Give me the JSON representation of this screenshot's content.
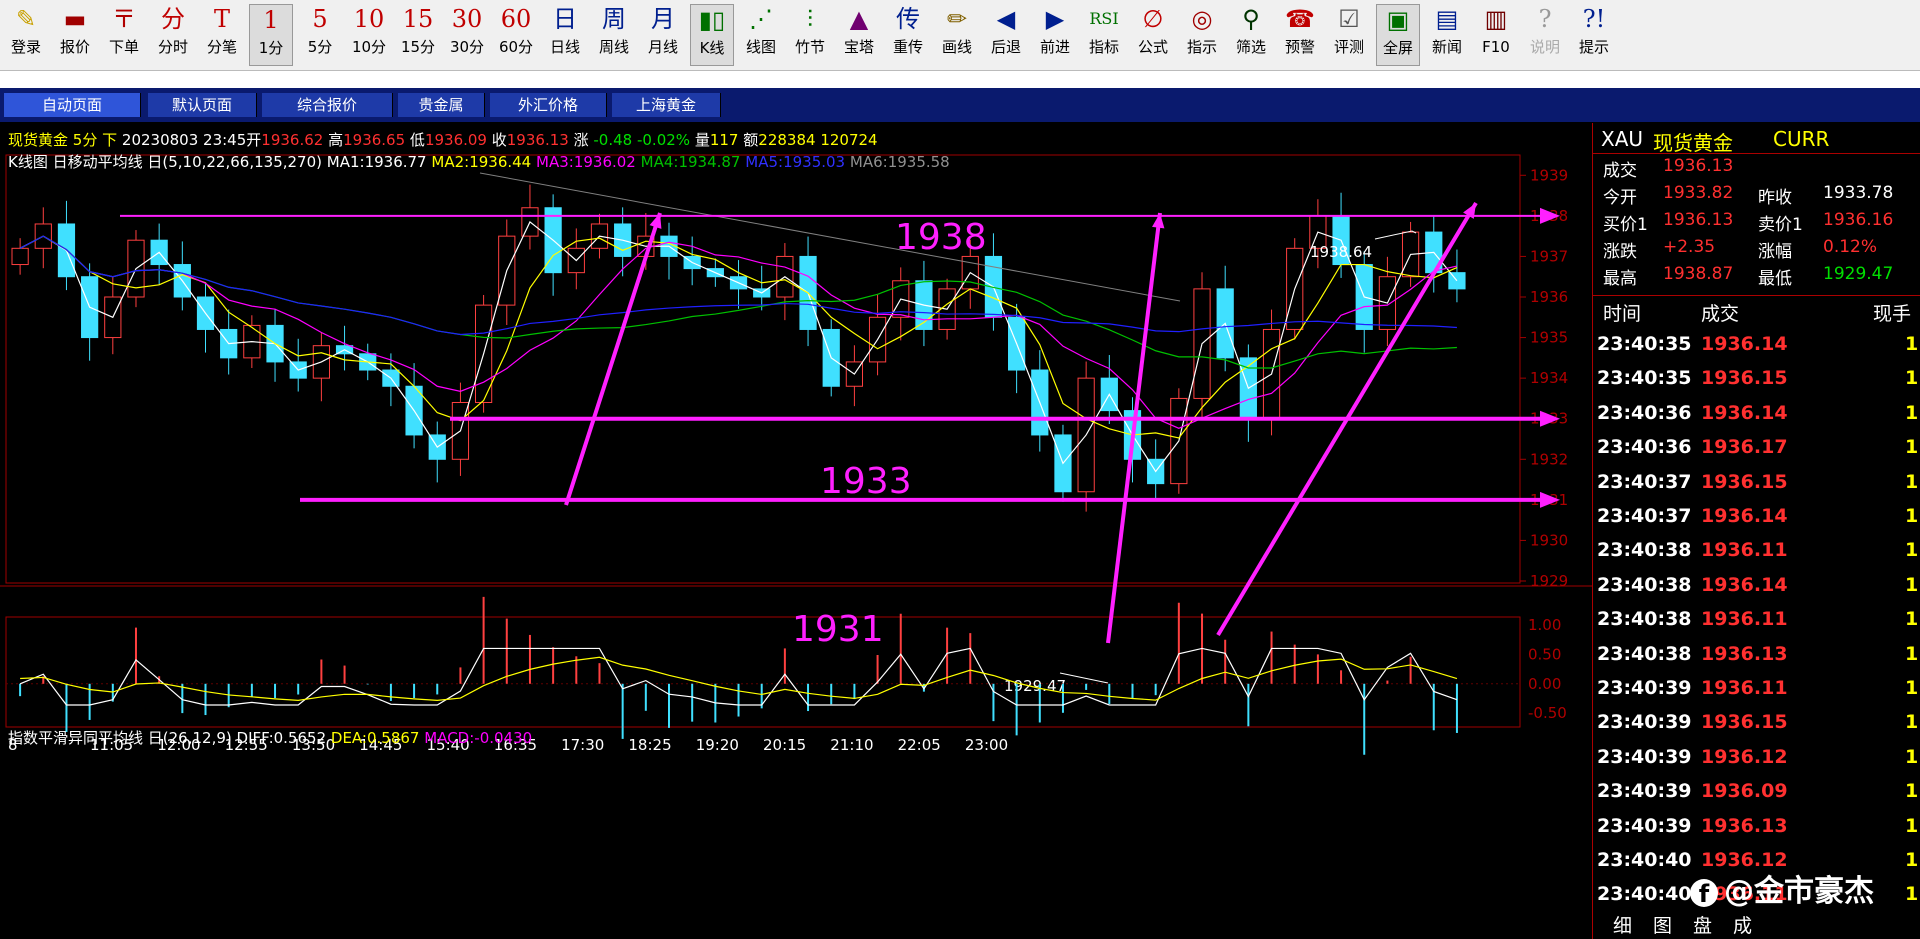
{
  "toolbar": [
    {
      "id": "login",
      "label": "登录",
      "icon": "✎",
      "color": "#c8a000",
      "icon_name": "pencil-icon"
    },
    {
      "id": "quote",
      "label": "报价",
      "icon": "▬",
      "color": "#a00000",
      "icon_name": "quote-icon"
    },
    {
      "id": "order",
      "label": "下单",
      "icon": "〒",
      "color": "#b00000",
      "icon_name": "order-icon"
    },
    {
      "id": "timeshare",
      "label": "分时",
      "icon": "分",
      "color": "#c00000",
      "icon_name": "timeshare-icon"
    },
    {
      "id": "ticks",
      "label": "分笔",
      "icon": "T",
      "color": "#c00000",
      "icon_name": "tick-icon"
    },
    {
      "id": "m1",
      "label": "1分",
      "icon": "1",
      "color": "#c00000",
      "icon_name": "period-1m-icon"
    },
    {
      "id": "m5",
      "label": "5分",
      "icon": "5",
      "color": "#c00000",
      "icon_name": "period-5m-icon"
    },
    {
      "id": "m10",
      "label": "10分",
      "icon": "10",
      "color": "#c00000",
      "icon_name": "period-10m-icon"
    },
    {
      "id": "m15",
      "label": "15分",
      "icon": "15",
      "color": "#c00000",
      "icon_name": "period-15m-icon"
    },
    {
      "id": "m30",
      "label": "30分",
      "icon": "30",
      "color": "#c00000",
      "icon_name": "period-30m-icon"
    },
    {
      "id": "m60",
      "label": "60分",
      "icon": "60",
      "color": "#c00000",
      "icon_name": "period-60m-icon"
    },
    {
      "id": "day",
      "label": "日线",
      "icon": "日",
      "color": "#001f8f",
      "icon_name": "daily-icon"
    },
    {
      "id": "week",
      "label": "周线",
      "icon": "周",
      "color": "#001f8f",
      "icon_name": "weekly-icon"
    },
    {
      "id": "month",
      "label": "月线",
      "icon": "月",
      "color": "#001f8f",
      "icon_name": "monthly-icon"
    },
    {
      "id": "kline",
      "label": "K线",
      "icon": "▮▯",
      "color": "#007000",
      "icon_name": "candlestick-icon"
    },
    {
      "id": "lineplot",
      "label": "线图",
      "icon": "⋰",
      "color": "#007000",
      "icon_name": "line-chart-icon"
    },
    {
      "id": "bamboo",
      "label": "竹节",
      "icon": "⫶",
      "color": "#007000",
      "icon_name": "ohlc-icon"
    },
    {
      "id": "tower",
      "label": "宝塔",
      "icon": "▲",
      "color": "#700070",
      "icon_name": "tower-icon"
    },
    {
      "id": "retrans",
      "label": "重传",
      "icon": "传",
      "color": "#001f8f",
      "icon_name": "retransmit-icon"
    },
    {
      "id": "draw",
      "label": "画线",
      "icon": "✏",
      "color": "#806000",
      "icon_name": "draw-line-icon"
    },
    {
      "id": "back",
      "label": "后退",
      "icon": "◀",
      "color": "#001f8f",
      "icon_name": "back-icon"
    },
    {
      "id": "forward",
      "label": "前进",
      "icon": "▶",
      "color": "#001f8f",
      "icon_name": "forward-icon"
    },
    {
      "id": "indicator",
      "label": "指标",
      "icon": "RSI",
      "color": "#007000",
      "icon_name": "rsi-icon"
    },
    {
      "id": "formula",
      "label": "公式",
      "icon": "∅",
      "color": "#c00000",
      "icon_name": "formula-icon"
    },
    {
      "id": "signal",
      "label": "指示",
      "icon": "◎",
      "color": "#a00000",
      "icon_name": "signal-icon"
    },
    {
      "id": "screen",
      "label": "筛选",
      "icon": "⚲",
      "color": "#003300",
      "icon_name": "binoculars-icon"
    },
    {
      "id": "alert",
      "label": "预警",
      "icon": "☎",
      "color": "#c00000",
      "icon_name": "alert-icon"
    },
    {
      "id": "review",
      "label": "评测",
      "icon": "☑",
      "color": "#555555",
      "icon_name": "review-icon"
    },
    {
      "id": "fullscreen",
      "label": "全屏",
      "icon": "▣",
      "color": "#007000",
      "icon_name": "fullscreen-icon"
    },
    {
      "id": "news",
      "label": "新闻",
      "icon": "▤",
      "color": "#001f8f",
      "icon_name": "news-icon"
    },
    {
      "id": "f10",
      "label": "F10",
      "icon": "▥",
      "color": "#700000",
      "icon_name": "f10-icon"
    },
    {
      "id": "help",
      "label": "说明",
      "icon": "?",
      "color": "#999999",
      "icon_name": "help-disabled-icon"
    },
    {
      "id": "tips",
      "label": "提示",
      "icon": "?!",
      "color": "#001f8f",
      "icon_name": "tips-icon"
    }
  ],
  "tabs": [
    "自动页面",
    "默认页面",
    "综合报价",
    "贵金属",
    "外汇价格",
    "上海黄金"
  ],
  "header": {
    "symbol": "现货黄金",
    "period": "5分",
    "dir": "下",
    "datetime": "20230803 23:45",
    "open_label": "开",
    "open": "1936.62",
    "high_label": "高",
    "high": "1936.65",
    "low_label": "低",
    "low": "1936.09",
    "close_label": "收",
    "close": "1936.13",
    "chg_label": "涨",
    "chg": "-0.48",
    "chg_pct": "-0.02%",
    "vol_label": "量",
    "vol": "117",
    "amt_label": "额",
    "amt": "228384",
    "extra": "120724"
  },
  "ma_line": {
    "title": "K线图 日移动平均线 日(5,10,22,66,135,270)",
    "ma1": "MA1:1936.77",
    "ma2": "MA2:1936.44",
    "ma3": "MA3:1936.02",
    "ma4": "MA4:1934.87",
    "ma5": "MA5:1935.03",
    "ma6": "MA6:1935.58"
  },
  "macd_line": {
    "title": "指数平滑异同平均线 日(26,12,9)",
    "diff": "DIFF:0.5652",
    "dea": "DEA:0.5867",
    "macd": "MACD:-0.0430"
  },
  "annotations": {
    "l1938": "1938",
    "l1933": "1933",
    "l1931": "1931",
    "high_mark": "1938.64",
    "low_mark": "1929.47"
  },
  "price_axis": [
    "1939",
    "1938",
    "1937",
    "1936",
    "1935",
    "1934",
    "1933",
    "1932",
    "1931",
    "1930",
    "1929"
  ],
  "macd_axis": [
    "1.00",
    "0.50",
    "0.00",
    "-0.50"
  ],
  "time_axis": [
    "8",
    "11:05",
    "12:00",
    "12:55",
    "13:50",
    "14:45",
    "15:40",
    "16:35",
    "17:30",
    "18:25",
    "19:20",
    "20:15",
    "21:10",
    "22:05",
    "23:00"
  ],
  "chart_data": {
    "type": "candlestick",
    "symbol": "XAU",
    "period": "5分",
    "close_path": [
      1937.2,
      1937.8,
      1936.5,
      1935.0,
      1936.0,
      1937.4,
      1936.8,
      1936.0,
      1935.2,
      1934.5,
      1935.3,
      1934.4,
      1934.0,
      1934.8,
      1934.6,
      1934.2,
      1933.8,
      1932.6,
      1932.0,
      1933.4,
      1935.8,
      1937.5,
      1938.2,
      1936.6,
      1937.2,
      1937.8,
      1937.0,
      1937.5,
      1937.0,
      1936.7,
      1936.5,
      1936.2,
      1936.0,
      1937.0,
      1935.2,
      1933.8,
      1934.4,
      1935.5,
      1936.4,
      1935.2,
      1936.2,
      1937.0,
      1935.5,
      1934.2,
      1932.6,
      1931.2,
      1934.0,
      1933.2,
      1932.0,
      1931.4,
      1933.5,
      1936.2,
      1934.5,
      1933.0,
      1935.2,
      1937.2,
      1938.0,
      1936.8,
      1935.2,
      1936.5,
      1937.6,
      1936.6,
      1936.2
    ],
    "ma_colors": {
      "ma1": "#ffffff",
      "ma2": "#ffff00",
      "ma3": "#ff00ff",
      "ma4": "#00c000",
      "ma5": "#0000ff",
      "ma6": "#808080"
    },
    "macd": {
      "diff": 0.5652,
      "dea": 0.5867,
      "macd": -0.043,
      "ylim": [
        -0.7,
        1.1
      ]
    },
    "ylim": [
      1929,
      1939.5
    ],
    "levels": [
      1938,
      1933,
      1931
    ],
    "high": 1938.64,
    "low": 1929.47
  },
  "panel": {
    "code": "XAU",
    "name": "现货黄金",
    "type": "CURR",
    "rows": [
      {
        "k": "成交",
        "v": "1936.13",
        "c": "#ff3030"
      },
      {
        "k": "今开",
        "v": "1933.82",
        "c": "#ff3030",
        "k2": "昨收",
        "v2": "1933.78",
        "c2": "#ffffff"
      },
      {
        "k": "买价1",
        "v": "1936.13",
        "c": "#ff3030",
        "k2": "卖价1",
        "v2": "1936.16",
        "c2": "#ff3030"
      },
      {
        "k": "涨跌",
        "v": "+2.35",
        "c": "#ff3030",
        "k2": "涨幅",
        "v2": "0.12%",
        "c2": "#ff3030"
      },
      {
        "k": "最高",
        "v": "1938.87",
        "c": "#ff3030",
        "k2": "最低",
        "v2": "1929.47",
        "c2": "#00e000"
      }
    ],
    "col_time": "时间",
    "col_price": "成交",
    "col_vol": "现手",
    "ticks": [
      {
        "t": "23:40:35",
        "p": "1936.14",
        "v": "1"
      },
      {
        "t": "23:40:35",
        "p": "1936.15",
        "v": "1"
      },
      {
        "t": "23:40:36",
        "p": "1936.14",
        "v": "1"
      },
      {
        "t": "23:40:36",
        "p": "1936.17",
        "v": "1"
      },
      {
        "t": "23:40:37",
        "p": "1936.15",
        "v": "1"
      },
      {
        "t": "23:40:37",
        "p": "1936.14",
        "v": "1"
      },
      {
        "t": "23:40:38",
        "p": "1936.11",
        "v": "1"
      },
      {
        "t": "23:40:38",
        "p": "1936.14",
        "v": "1"
      },
      {
        "t": "23:40:38",
        "p": "1936.11",
        "v": "1"
      },
      {
        "t": "23:40:38",
        "p": "1936.13",
        "v": "1"
      },
      {
        "t": "23:40:39",
        "p": "1936.11",
        "v": "1"
      },
      {
        "t": "23:40:39",
        "p": "1936.15",
        "v": "1"
      },
      {
        "t": "23:40:39",
        "p": "1936.12",
        "v": "1"
      },
      {
        "t": "23:40:39",
        "p": "1936.09",
        "v": "1"
      },
      {
        "t": "23:40:39",
        "p": "1936.13",
        "v": "1"
      },
      {
        "t": "23:40:40",
        "p": "1936.12",
        "v": "1"
      },
      {
        "t": "23:40:40",
        "p": "1936.11",
        "v": "1"
      }
    ],
    "bottom_tabs": [
      "细",
      "图",
      "盘",
      "成"
    ]
  },
  "watermark": "@金市豪杰"
}
